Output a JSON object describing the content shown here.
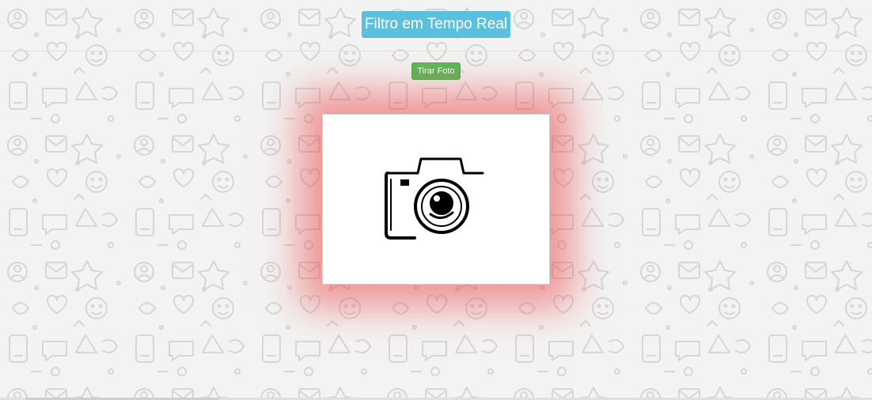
{
  "header": {
    "title": "Filtro em Tempo Real",
    "title_color": "#5bc0de"
  },
  "controls": {
    "take_photo_label": "Tirar Foto",
    "take_photo_color": "#5cb85c"
  },
  "preview": {
    "placeholder_icon": "camera-icon",
    "glow_color": "#eb4646"
  },
  "background": {
    "pattern": "doodle-pattern",
    "base_color": "#f3f3f3"
  }
}
